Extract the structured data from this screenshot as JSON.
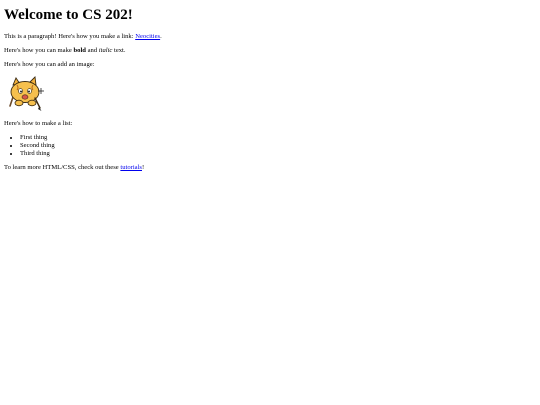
{
  "heading": "Welcome to CS 202!",
  "para1": {
    "before": "This is a paragraph! Here's how you make a link: ",
    "link": "Neocities",
    "after": "."
  },
  "para2": {
    "before": "Here's how you can make ",
    "bold": "bold",
    "middle": " and ",
    "italic": "italic",
    "after": " text."
  },
  "para3": "Here's how you can add an image:",
  "image": {
    "icon": "neocities-cat-mascot-icon"
  },
  "para4": "Here's how to make a list:",
  "list": [
    "First thing",
    "Second thing",
    "Third thing"
  ],
  "para5": {
    "before": "To learn more HTML/CSS, check out these ",
    "link": "tutorials",
    "after": "!"
  },
  "colors": {
    "link": "#0000ee",
    "text": "#000000",
    "background": "#ffffff"
  }
}
